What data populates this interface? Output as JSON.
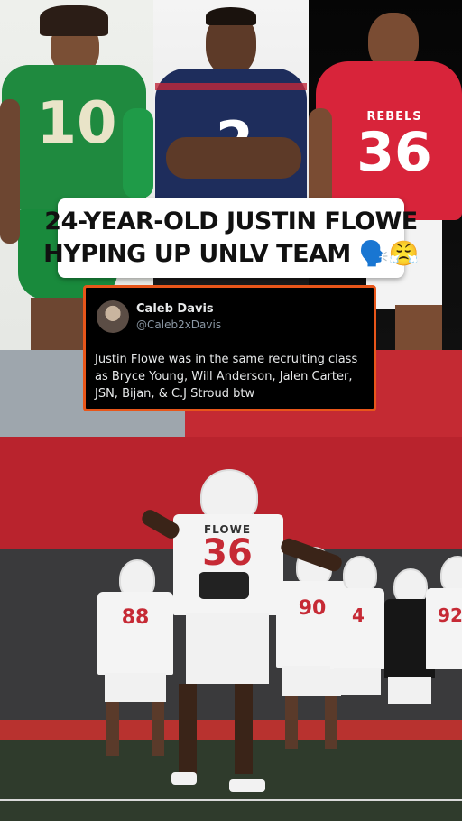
{
  "headline": {
    "line1": "24-YEAR-OLD JUSTIN FLOWE",
    "line2": "HYPING UP UNLV TEAM 🗣️😤"
  },
  "tweet": {
    "name": "Caleb Davis",
    "handle": "@Caleb2xDavis",
    "text": "Justin Flowe was in the same recruiting class as Bryce Young, Will Anderson, Jalen Carter, JSN, Bijan, & C.J Stroud btw"
  },
  "photos": {
    "p1_jersey": "10",
    "p2_jersey": "2",
    "p3_jersey_name": "REBELS",
    "p3_jersey": "36",
    "practice_main_name": "FLOWE",
    "practice_main_number": "36",
    "practice_numbers": [
      "88",
      "90",
      "4",
      "92"
    ]
  },
  "colors": {
    "oregon_green": "#1f8a3f",
    "navy": "#1e2d5c",
    "unlv_red": "#d8243a",
    "tweet_border": "#e8561a"
  }
}
